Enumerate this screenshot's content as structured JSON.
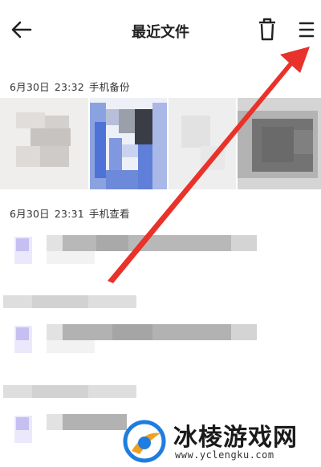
{
  "header": {
    "title": "最近文件",
    "back_icon": "arrow-left-icon",
    "delete_icon": "trash-icon",
    "menu_icon": "menu-icon"
  },
  "groups": [
    {
      "date": "6月30日",
      "time": "23:32",
      "source": "手机备份"
    },
    {
      "date": "6月30日",
      "time": "23:31",
      "source": "手机查看"
    }
  ],
  "annotation": {
    "arrow_color": "#e8322a"
  },
  "watermark": {
    "title": "冰棱游戏网",
    "url": "www.yclengku.com",
    "logo_colors": [
      "#1f7de0",
      "#f0a020"
    ]
  }
}
